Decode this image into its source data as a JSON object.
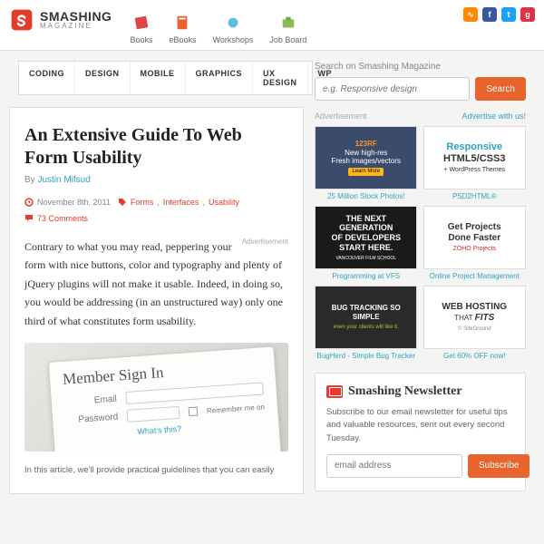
{
  "brand": {
    "name": "SMASHING",
    "sub": "MAGAZINE"
  },
  "topnav": [
    "Books",
    "eBooks",
    "Workshops",
    "Job Board"
  ],
  "nav": [
    "CODING",
    "DESIGN",
    "MOBILE",
    "GRAPHICS",
    "UX DESIGN",
    "WP"
  ],
  "article": {
    "title": "An Extensive Guide To Web Form Usability",
    "by": "By ",
    "author": "Justin Mifsud",
    "date": "November 8th, 2011",
    "tags": [
      "Forms",
      "Interfaces",
      "Usability"
    ],
    "comments": "73 Comments",
    "ad_label": "Advertisement",
    "body": "Contrary to what you may read, peppering your form with nice buttons, color and typography and plenty of jQuery plugins will not make it usable. Indeed, in doing so, you would be addressing (in an unstructured way) only one third of what constitutes form usability.",
    "hero": {
      "heading": "Member Sign In",
      "email": "Email",
      "password": "Password",
      "remember": "Remember me on",
      "whats": "What's this?"
    },
    "footer": "In this article, we'll provide practical guidelines that you can easily"
  },
  "search": {
    "label": "Search on Smashing Magazine",
    "placeholder": "e.g. Responsive design",
    "button": "Search"
  },
  "adv": {
    "a": "Advertisement",
    "b": "Advertise with us!"
  },
  "ads": [
    {
      "cap": "25 Million Stock Photos!"
    },
    {
      "cap": "PSD2HTML®"
    },
    {
      "cap": "Programming at VFS"
    },
    {
      "cap": "Online Project Management"
    },
    {
      "cap": "BugHerd - Simple Bug Tracker"
    },
    {
      "cap": "Get 60% OFF now!"
    }
  ],
  "ad_text": {
    "a1_brand": "123RF",
    "a1_l1": "New high-res",
    "a1_l2": "Fresh images/vectors",
    "a1_btn": "Learn More",
    "a2_l1": "Responsive",
    "a2_l2": "HTML5/CSS3",
    "a2_l3": "+ WordPress Themes",
    "a3_l1": "THE NEXT GENERATION",
    "a3_l2": "OF DEVELOPERS",
    "a3_l3": "START HERE.",
    "a3_sub": "VANCOUVER FILM SCHOOL",
    "a4_l1": "Get Projects",
    "a4_l2": "Done Faster",
    "a4_logo": "ZOHO Projects",
    "a5_l1": "BUG TRACKING SO SIMPLE",
    "a5_l2": "even your clients will like it.",
    "a6_l1": "WEB HOSTING",
    "a6_l2": "THAT",
    "a6_l3": "FITS",
    "a6_sg": "© SiteGround"
  },
  "newsletter": {
    "title": "Smashing Newsletter",
    "body": "Subscribe to our email newsletter for useful tips and valuable resources, sent out every second Tuesday.",
    "placeholder": "email address",
    "button": "Subscribe"
  },
  "colors": {
    "accent": "#e8642c",
    "red": "#e53b2c",
    "link": "#2da2c5"
  }
}
